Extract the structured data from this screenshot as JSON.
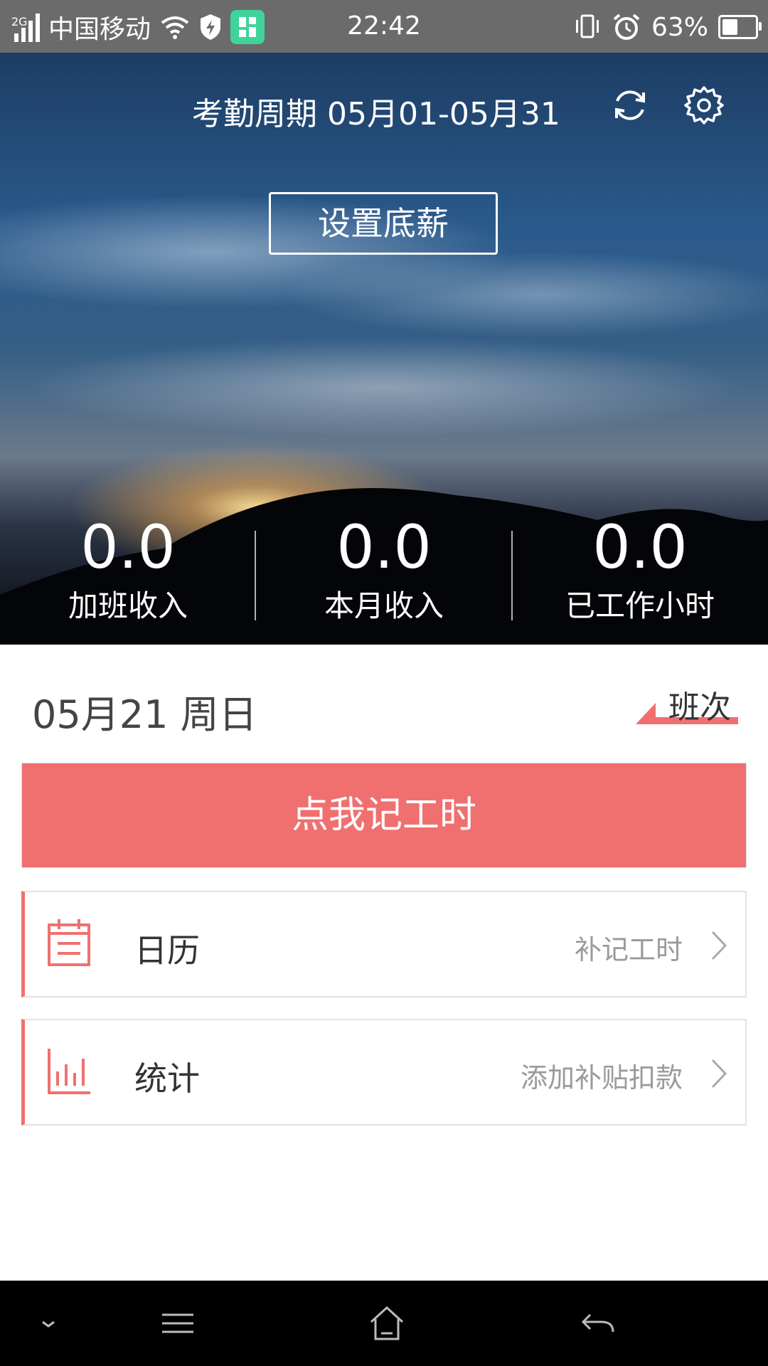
{
  "status_bar": {
    "network_type": "2G",
    "carrier": "中国移动",
    "time": "22:42",
    "battery": "63%",
    "battery_level": 0.63,
    "icons": [
      "signal-icon",
      "wifi-icon",
      "shield-icon",
      "app-icon",
      "vibrate-icon",
      "alarm-icon",
      "battery-icon"
    ]
  },
  "header": {
    "cycle_label": "考勤周期 05月01-05月31",
    "set_salary_label": "设置底薪",
    "icons": [
      "refresh-icon",
      "settings-icon"
    ]
  },
  "stats": [
    {
      "value": "0.0",
      "label": "加班收入"
    },
    {
      "value": "0.0",
      "label": "本月收入"
    },
    {
      "value": "0.0",
      "label": "已工作小时"
    }
  ],
  "today": {
    "date_label": "05月21 周日",
    "shift_label": "班次"
  },
  "record_button": "点我记工时",
  "rows": [
    {
      "title": "日历",
      "subtitle": "补记工时",
      "icon": "calendar-icon"
    },
    {
      "title": "统计",
      "subtitle": "添加补贴扣款",
      "icon": "bar-chart-icon"
    }
  ],
  "colors": {
    "accent": "#f07070",
    "status_bar": "#6b6b6b",
    "nav_bar": "#000000"
  },
  "nav_bar": {
    "icons": [
      "collapse-icon",
      "menu-icon",
      "home-icon",
      "back-icon"
    ]
  }
}
